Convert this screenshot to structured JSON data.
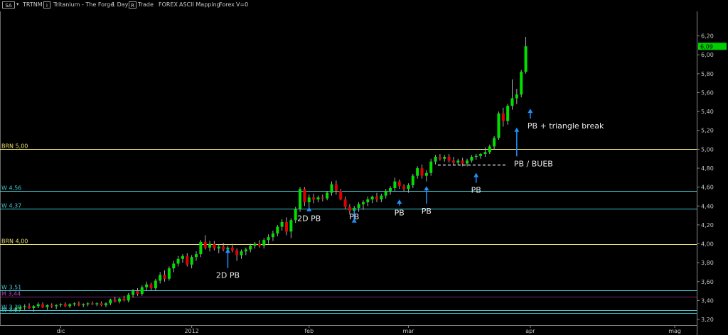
{
  "toolbar": {
    "symbol_box": "SA",
    "ticker": "TRTNM",
    "i_box": "i",
    "name": "Tritanium - The Forge",
    "timeframe": "1 Day",
    "r_box": "R",
    "trade_text": "Trade",
    "forex_text": "FOREX",
    "mapping_text": "ASCII Mapping",
    "forex2_text": "Forex",
    "v_text": "V=0"
  },
  "colors": {
    "background": "#000000",
    "up_candle": "#00e000",
    "down_candle": "#e00000",
    "wick": "#b0b0b0",
    "brn_line": "#e8e070",
    "w_line": "#40c8d0",
    "w_line_low": "#c040c0",
    "annotation": "#e8e8e8",
    "arrow": "#1e90ff",
    "price_badge": "#00d000"
  },
  "chart_data": {
    "type": "candlestick",
    "x_labels": [
      "dic",
      "2012",
      "feb",
      "mar",
      "apr",
      "mag"
    ],
    "y_ticks": [
      "6,20",
      "6,00",
      "5,80",
      "5,60",
      "5,40",
      "5,20",
      "5,00",
      "4,80",
      "4,60",
      "4,40",
      "4,20",
      "4,00",
      "3,80",
      "3,60",
      "3,40",
      "3,20"
    ],
    "ylim": [
      3.14,
      6.46
    ],
    "last_price": "6,09",
    "ohlc": [
      [
        3.3,
        3.33,
        3.28,
        3.31
      ],
      [
        3.31,
        3.34,
        3.29,
        3.33
      ],
      [
        3.33,
        3.36,
        3.3,
        3.34
      ],
      [
        3.34,
        3.37,
        3.31,
        3.32
      ],
      [
        3.32,
        3.35,
        3.28,
        3.34
      ],
      [
        3.34,
        3.38,
        3.32,
        3.36
      ],
      [
        3.36,
        3.38,
        3.32,
        3.33
      ],
      [
        3.33,
        3.36,
        3.3,
        3.35
      ],
      [
        3.35,
        3.37,
        3.32,
        3.34
      ],
      [
        3.34,
        3.36,
        3.31,
        3.35
      ],
      [
        3.35,
        3.37,
        3.33,
        3.36
      ],
      [
        3.36,
        3.38,
        3.33,
        3.34
      ],
      [
        3.34,
        3.37,
        3.32,
        3.36
      ],
      [
        3.36,
        3.38,
        3.34,
        3.37
      ],
      [
        3.37,
        3.39,
        3.34,
        3.35
      ],
      [
        3.35,
        3.37,
        3.33,
        3.36
      ],
      [
        3.36,
        3.38,
        3.34,
        3.37
      ],
      [
        3.37,
        3.39,
        3.35,
        3.36
      ],
      [
        3.36,
        3.38,
        3.34,
        3.37
      ],
      [
        3.37,
        3.39,
        3.34,
        3.35
      ],
      [
        3.35,
        3.38,
        3.33,
        3.37
      ],
      [
        3.37,
        3.42,
        3.35,
        3.41
      ],
      [
        3.41,
        3.44,
        3.38,
        3.39
      ],
      [
        3.39,
        3.43,
        3.37,
        3.42
      ],
      [
        3.42,
        3.45,
        3.39,
        3.4
      ],
      [
        3.4,
        3.48,
        3.38,
        3.46
      ],
      [
        3.46,
        3.52,
        3.43,
        3.5
      ],
      [
        3.5,
        3.53,
        3.45,
        3.47
      ],
      [
        3.47,
        3.56,
        3.45,
        3.54
      ],
      [
        3.54,
        3.6,
        3.5,
        3.57
      ],
      [
        3.57,
        3.59,
        3.51,
        3.53
      ],
      [
        3.53,
        3.63,
        3.51,
        3.61
      ],
      [
        3.61,
        3.7,
        3.58,
        3.67
      ],
      [
        3.67,
        3.72,
        3.6,
        3.63
      ],
      [
        3.63,
        3.76,
        3.61,
        3.74
      ],
      [
        3.74,
        3.82,
        3.7,
        3.79
      ],
      [
        3.79,
        3.87,
        3.76,
        3.84
      ],
      [
        3.84,
        3.89,
        3.8,
        3.87
      ],
      [
        3.87,
        3.9,
        3.76,
        3.78
      ],
      [
        3.78,
        3.88,
        3.74,
        3.86
      ],
      [
        3.86,
        3.92,
        3.82,
        3.89
      ],
      [
        3.89,
        4.04,
        3.86,
        4.02
      ],
      [
        4.02,
        4.09,
        3.94,
        3.96
      ],
      [
        3.96,
        4.03,
        3.92,
        4.0
      ],
      [
        4.0,
        4.03,
        3.93,
        3.95
      ],
      [
        3.95,
        3.99,
        3.9,
        3.97
      ],
      [
        3.97,
        4.01,
        3.92,
        3.94
      ],
      [
        3.94,
        3.98,
        3.89,
        3.96
      ],
      [
        3.96,
        4.0,
        3.91,
        3.93
      ],
      [
        3.93,
        3.95,
        3.82,
        3.88
      ],
      [
        3.88,
        3.94,
        3.84,
        3.92
      ],
      [
        3.92,
        3.96,
        3.88,
        3.94
      ],
      [
        3.94,
        4.0,
        3.91,
        3.98
      ],
      [
        3.98,
        4.02,
        3.95,
        4.0
      ],
      [
        4.0,
        4.04,
        3.96,
        3.98
      ],
      [
        3.98,
        4.06,
        3.95,
        4.04
      ],
      [
        4.04,
        4.1,
        4.0,
        4.07
      ],
      [
        4.07,
        4.14,
        4.03,
        4.11
      ],
      [
        4.11,
        4.2,
        4.08,
        4.18
      ],
      [
        4.18,
        4.26,
        4.14,
        4.23
      ],
      [
        4.23,
        4.28,
        4.09,
        4.13
      ],
      [
        4.13,
        4.27,
        4.06,
        4.25
      ],
      [
        4.25,
        4.39,
        4.22,
        4.37
      ],
      [
        4.37,
        4.6,
        4.34,
        4.58
      ],
      [
        4.58,
        4.6,
        4.4,
        4.44
      ],
      [
        4.44,
        4.52,
        4.38,
        4.49
      ],
      [
        4.49,
        4.53,
        4.43,
        4.47
      ],
      [
        4.47,
        4.51,
        4.44,
        4.49
      ],
      [
        4.49,
        4.52,
        4.45,
        4.48
      ],
      [
        4.48,
        4.56,
        4.46,
        4.54
      ],
      [
        4.54,
        4.66,
        4.51,
        4.63
      ],
      [
        4.63,
        4.67,
        4.52,
        4.56
      ],
      [
        4.56,
        4.58,
        4.46,
        4.47
      ],
      [
        4.47,
        4.5,
        4.37,
        4.39
      ],
      [
        4.39,
        4.42,
        4.31,
        4.35
      ],
      [
        4.35,
        4.4,
        4.3,
        4.38
      ],
      [
        4.38,
        4.44,
        4.34,
        4.42
      ],
      [
        4.42,
        4.46,
        4.36,
        4.44
      ],
      [
        4.44,
        4.5,
        4.4,
        4.47
      ],
      [
        4.47,
        4.51,
        4.43,
        4.5
      ],
      [
        4.5,
        4.54,
        4.44,
        4.47
      ],
      [
        4.47,
        4.53,
        4.44,
        4.51
      ],
      [
        4.51,
        4.58,
        4.48,
        4.56
      ],
      [
        4.56,
        4.61,
        4.52,
        4.59
      ],
      [
        4.59,
        4.7,
        4.56,
        4.66
      ],
      [
        4.66,
        4.68,
        4.58,
        4.61
      ],
      [
        4.61,
        4.63,
        4.55,
        4.58
      ],
      [
        4.58,
        4.64,
        4.54,
        4.62
      ],
      [
        4.62,
        4.74,
        4.59,
        4.72
      ],
      [
        4.72,
        4.82,
        4.69,
        4.8
      ],
      [
        4.8,
        4.84,
        4.69,
        4.72
      ],
      [
        4.72,
        4.78,
        4.66,
        4.75
      ],
      [
        4.75,
        4.9,
        4.72,
        4.87
      ],
      [
        4.87,
        4.94,
        4.84,
        4.92
      ],
      [
        4.92,
        4.95,
        4.88,
        4.9
      ],
      [
        4.9,
        4.94,
        4.87,
        4.92
      ],
      [
        4.92,
        4.95,
        4.86,
        4.88
      ],
      [
        4.88,
        4.92,
        4.84,
        4.86
      ],
      [
        4.86,
        4.9,
        4.83,
        4.88
      ],
      [
        4.88,
        4.91,
        4.82,
        4.85
      ],
      [
        4.85,
        4.9,
        4.82,
        4.88
      ],
      [
        4.88,
        4.94,
        4.86,
        4.92
      ],
      [
        4.92,
        4.95,
        4.89,
        4.93
      ],
      [
        4.93,
        4.96,
        4.9,
        4.95
      ],
      [
        4.95,
        5.02,
        4.92,
        4.97
      ],
      [
        4.97,
        5.05,
        4.95,
        5.03
      ],
      [
        5.03,
        5.14,
        5.0,
        5.12
      ],
      [
        5.12,
        5.4,
        5.1,
        5.38
      ],
      [
        5.38,
        5.44,
        5.24,
        5.3
      ],
      [
        5.3,
        5.48,
        5.26,
        5.46
      ],
      [
        5.46,
        5.74,
        5.42,
        5.54
      ],
      [
        5.54,
        5.64,
        5.48,
        5.58
      ],
      [
        5.58,
        5.84,
        5.55,
        5.82
      ],
      [
        5.82,
        6.19,
        5.8,
        6.09
      ]
    ],
    "horizontal_lines": [
      {
        "label": "BRN 5,00",
        "value": 5.0,
        "kind": "brn"
      },
      {
        "label": "W 4,56",
        "value": 4.56,
        "kind": "w"
      },
      {
        "label": "W 4,37",
        "value": 4.37,
        "kind": "w"
      },
      {
        "label": "BRN 4,00",
        "value": 4.0,
        "kind": "brn"
      },
      {
        "label": "W 3,51",
        "value": 3.51,
        "kind": "w"
      },
      {
        "label": "M 3,44",
        "value": 3.44,
        "kind": "m"
      },
      {
        "label": "W 3,30",
        "value": 3.3,
        "kind": "w"
      },
      {
        "label": "W 3,27",
        "value": 3.27,
        "kind": "w"
      }
    ],
    "annotations": [
      {
        "text": "2D PB",
        "bar": 47,
        "text_price": 3.64,
        "tip_price": 3.98
      },
      {
        "text": "2D PB",
        "bar": 65,
        "text_price": 4.24,
        "tip_price": 4.42
      },
      {
        "text": "PB",
        "bar": 75,
        "text_price": 4.26,
        "tip_price": 4.3
      },
      {
        "text": "PB",
        "bar": 85,
        "text_price": 4.3,
        "tip_price": 4.5
      },
      {
        "text": "PB",
        "bar": 91,
        "text_price": 4.32,
        "tip_price": 4.64
      },
      {
        "text": "PB",
        "bar": 102,
        "text_price": 4.54,
        "tip_price": 4.78
      },
      {
        "text": "PB / BUEB",
        "bar": 111,
        "text_price": 4.82,
        "tip_price": 5.26
      },
      {
        "text": "PB + triangle break",
        "bar": 114,
        "text_price": 5.22,
        "tip_price": 5.46
      }
    ],
    "dashed_level": {
      "value": 4.84,
      "from_bar": 94,
      "to_bar": 108
    }
  }
}
